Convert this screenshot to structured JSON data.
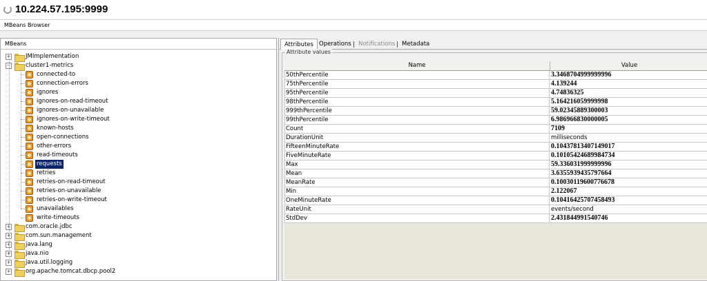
{
  "window": {
    "host": "10.224.57.195:9999"
  },
  "subbar": {
    "title": "MBeans Browser"
  },
  "left_panel": {
    "header": "MBeans",
    "tree": [
      {
        "label": "JMImplementation",
        "type": "folder",
        "level": 0,
        "expanded": false
      },
      {
        "label": "cluster1-metrics",
        "type": "folder",
        "level": 0,
        "expanded": true
      },
      {
        "label": "connected-to",
        "type": "bean",
        "level": 1
      },
      {
        "label": "connection-errors",
        "type": "bean",
        "level": 1
      },
      {
        "label": "ignores",
        "type": "bean",
        "level": 1
      },
      {
        "label": "ignores-on-read-timeout",
        "type": "bean",
        "level": 1
      },
      {
        "label": "ignores-on-unavailable",
        "type": "bean",
        "level": 1
      },
      {
        "label": "ignores-on-write-timeout",
        "type": "bean",
        "level": 1
      },
      {
        "label": "known-hosts",
        "type": "bean",
        "level": 1
      },
      {
        "label": "open-connections",
        "type": "bean",
        "level": 1
      },
      {
        "label": "other-errors",
        "type": "bean",
        "level": 1
      },
      {
        "label": "read-timeouts",
        "type": "bean",
        "level": 1
      },
      {
        "label": "requests",
        "type": "bean",
        "level": 1,
        "selected": true
      },
      {
        "label": "retries",
        "type": "bean",
        "level": 1
      },
      {
        "label": "retries-on-read-timeout",
        "type": "bean",
        "level": 1
      },
      {
        "label": "retries-on-unavailable",
        "type": "bean",
        "level": 1
      },
      {
        "label": "retries-on-write-timeout",
        "type": "bean",
        "level": 1
      },
      {
        "label": "unavailables",
        "type": "bean",
        "level": 1
      },
      {
        "label": "write-timeouts",
        "type": "bean",
        "level": 1
      },
      {
        "label": "com.oracle.jdbc",
        "type": "folder",
        "level": 0,
        "expanded": false
      },
      {
        "label": "com.sun.management",
        "type": "folder",
        "level": 0,
        "expanded": false
      },
      {
        "label": "java.lang",
        "type": "folder",
        "level": 0,
        "expanded": false
      },
      {
        "label": "java.nio",
        "type": "folder",
        "level": 0,
        "expanded": false
      },
      {
        "label": "java.util.logging",
        "type": "folder",
        "level": 0,
        "expanded": false
      },
      {
        "label": "org.apache.tomcat.dbcp.pool2",
        "type": "folder",
        "level": 0,
        "expanded": false
      }
    ]
  },
  "right_panel": {
    "tabs": [
      {
        "label": "Attributes",
        "active": true,
        "disabled": false
      },
      {
        "label": "Operations",
        "active": false,
        "disabled": false
      },
      {
        "label": "Notifications",
        "active": false,
        "disabled": true
      },
      {
        "label": "Metadata",
        "active": false,
        "disabled": false
      }
    ],
    "group_title": "Attribute values",
    "columns": {
      "name": "Name",
      "value": "Value"
    },
    "attributes": [
      {
        "name": "50thPercentile",
        "value": "3.3468704999999996",
        "bold": true
      },
      {
        "name": "75thPercentile",
        "value": "4.139244",
        "bold": true
      },
      {
        "name": "95thPercentile",
        "value": "4.74836325",
        "bold": true
      },
      {
        "name": "98thPercentile",
        "value": "5.164216059999998",
        "bold": true
      },
      {
        "name": "999thPercentile",
        "value": "59.02345889300003",
        "bold": true
      },
      {
        "name": "99thPercentile",
        "value": "6.986966830000005",
        "bold": true
      },
      {
        "name": "Count",
        "value": "7109",
        "bold": true
      },
      {
        "name": "DurationUnit",
        "value": "milliseconds",
        "bold": false
      },
      {
        "name": "FifteenMinuteRate",
        "value": "0.10437813407149017",
        "bold": true
      },
      {
        "name": "FiveMinuteRate",
        "value": "0.10105424689984734",
        "bold": true
      },
      {
        "name": "Max",
        "value": "59.336031999999996",
        "bold": true
      },
      {
        "name": "Mean",
        "value": "3.6355939435797664",
        "bold": true
      },
      {
        "name": "MeanRate",
        "value": "0.10030119600776678",
        "bold": true
      },
      {
        "name": "Min",
        "value": "2.122067",
        "bold": true
      },
      {
        "name": "OneMinuteRate",
        "value": "0.10416425707458493",
        "bold": true
      },
      {
        "name": "RateUnit",
        "value": "events/second",
        "bold": false
      },
      {
        "name": "StdDev",
        "value": "2.431844991540746",
        "bold": true
      }
    ]
  }
}
